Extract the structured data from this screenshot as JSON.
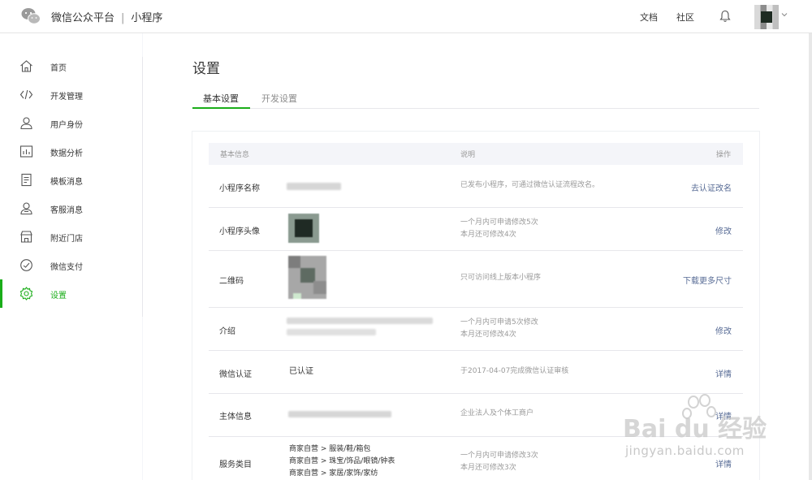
{
  "header": {
    "brand": "微信公众平台",
    "separator": "|",
    "product": "小程序",
    "docs": "文档",
    "community": "社区"
  },
  "sidebar": {
    "items": [
      {
        "label": "首页",
        "icon": "home-icon"
      },
      {
        "label": "开发管理",
        "icon": "code-icon"
      },
      {
        "label": "用户身份",
        "icon": "user-icon"
      },
      {
        "label": "数据分析",
        "icon": "chart-icon"
      },
      {
        "label": "模板消息",
        "icon": "document-icon"
      },
      {
        "label": "客服消息",
        "icon": "service-user-icon"
      },
      {
        "label": "附近门店",
        "icon": "store-icon"
      },
      {
        "label": "微信支付",
        "icon": "pay-icon"
      },
      {
        "label": "设置",
        "icon": "gear-icon"
      }
    ],
    "active_index": 8,
    "accent": "#1aad19"
  },
  "page": {
    "title": "设置",
    "tabs": [
      {
        "label": "基本设置",
        "active": true
      },
      {
        "label": "开发设置",
        "active": false
      }
    ]
  },
  "table": {
    "headers": {
      "info": "基本信息",
      "desc": "说明",
      "op": "操作"
    },
    "rows": [
      {
        "label": "小程序名称",
        "desc": [
          "已发布小程序，可通过微信认证流程改名。"
        ],
        "op": "去认证改名"
      },
      {
        "label": "小程序头像",
        "desc": [
          "一个月内可申请修改5次",
          "本月还可修改4次"
        ],
        "op": "修改"
      },
      {
        "label": "二维码",
        "desc": [
          "只可访问线上版本小程序"
        ],
        "op": "下载更多尺寸"
      },
      {
        "label": "介绍",
        "desc": [
          "一个月内可申请5次修改",
          "本月还可修改4次"
        ],
        "op": "修改"
      },
      {
        "label": "微信认证",
        "value": "已认证",
        "desc": [
          "于2017-04-07完成微信认证审核"
        ],
        "op": "详情"
      },
      {
        "label": "主体信息",
        "desc": [
          "企业法人及个体工商户"
        ],
        "op": "详情"
      },
      {
        "label": "服务类目",
        "value_lines": [
          "商家自营 > 服装/鞋/箱包",
          "商家自营 > 珠宝/饰品/眼镜/钟表",
          "商家自营 > 家居/家饰/家纺"
        ],
        "desc": [
          "一个月内可申请修改3次",
          "本月还可修改3次"
        ],
        "op": "详情"
      }
    ],
    "link_color": "#576b95"
  },
  "watermark": {
    "brand": "Bai du 经验",
    "url": "jingyan.baidu.com"
  }
}
